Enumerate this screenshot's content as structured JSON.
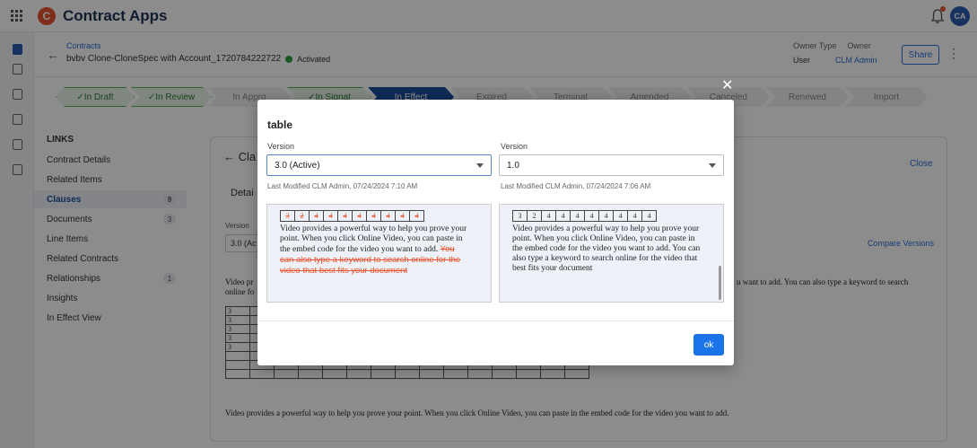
{
  "app": {
    "logo_letter": "C",
    "title": "Contract Apps",
    "avatar_initials": "CA"
  },
  "header": {
    "breadcrumb": "Contracts",
    "record_title": "bvbv Clone-CloneSpec with Account_1720784222722",
    "status": "Activated",
    "owner_type_label": "Owner Type",
    "owner_label": "Owner",
    "owner_type_value": "User",
    "owner_value": "CLM Admin",
    "share_label": "Share"
  },
  "stages": [
    {
      "label": "✓In Draft",
      "state": "done"
    },
    {
      "label": "✓In Review",
      "state": "done"
    },
    {
      "label": "In Appro",
      "state": "todo"
    },
    {
      "label": "✓In Signat",
      "state": "done"
    },
    {
      "label": "In Effect",
      "state": "current"
    },
    {
      "label": "Expired",
      "state": "todo"
    },
    {
      "label": "Terminat",
      "state": "todo"
    },
    {
      "label": "Amended",
      "state": "todo"
    },
    {
      "label": "Canceled",
      "state": "todo"
    },
    {
      "label": "Renewed",
      "state": "todo"
    },
    {
      "label": "Import",
      "state": "todo"
    }
  ],
  "links": {
    "title": "LINKS",
    "items": [
      {
        "label": "Contract Details"
      },
      {
        "label": "Related Items"
      },
      {
        "label": "Clauses",
        "badge": "9",
        "active": true
      },
      {
        "label": "Documents",
        "badge": "3"
      },
      {
        "label": "Line Items"
      },
      {
        "label": "Related Contracts"
      },
      {
        "label": "Relationships",
        "badge": "1"
      },
      {
        "label": "Insights"
      },
      {
        "label": "In Effect View"
      }
    ]
  },
  "card": {
    "back_label": "← Cla",
    "close_label": "Close",
    "tab_label": "Detai",
    "version_label": "Version",
    "version_value": "3.0 (Ac",
    "compare_label": "Compare Versions",
    "para1_left": "Video pr online fo",
    "para1_right": "u want to add. You can also type a keyword to search",
    "table_rows": [
      "3",
      "3",
      "3",
      "3",
      "3",
      "",
      "",
      ""
    ],
    "para2": "Video provides a powerful way to help you prove your point. When you click Online Video, you can paste in the embed code for the video you want to add."
  },
  "modal": {
    "title": "table",
    "left": {
      "version_label": "Version",
      "version_value": "3.0 (Active)",
      "modified": "Last Modified CLM Admin, 07/24/2024 7:10 AM",
      "table_cells": [
        "3",
        "2",
        "4",
        "4",
        "4",
        "4",
        "4",
        "4",
        "4",
        "4"
      ],
      "text": "Video provides a powerful way to help you prove your point. When you click Online Video, you can paste in the embed code for the video you want to add.",
      "deleted_text": "You can also type a keyword to search online for the video that best fits your document"
    },
    "right": {
      "version_label": "Version",
      "version_value": "1.0",
      "modified": "Last Modified CLM Admin, 07/24/2024 7:06 AM",
      "table_cells": [
        "3",
        "2",
        "4",
        "4",
        "4",
        "4",
        "4",
        "4",
        "4",
        "4"
      ],
      "text": "Video provides a powerful way to help you prove your point. When you click Online Video, you can paste in the embed code for the video you want to add. You can also type a keyword to search online for the video that best fits your document"
    },
    "ok_label": "ok",
    "close_glyph": "✕"
  }
}
